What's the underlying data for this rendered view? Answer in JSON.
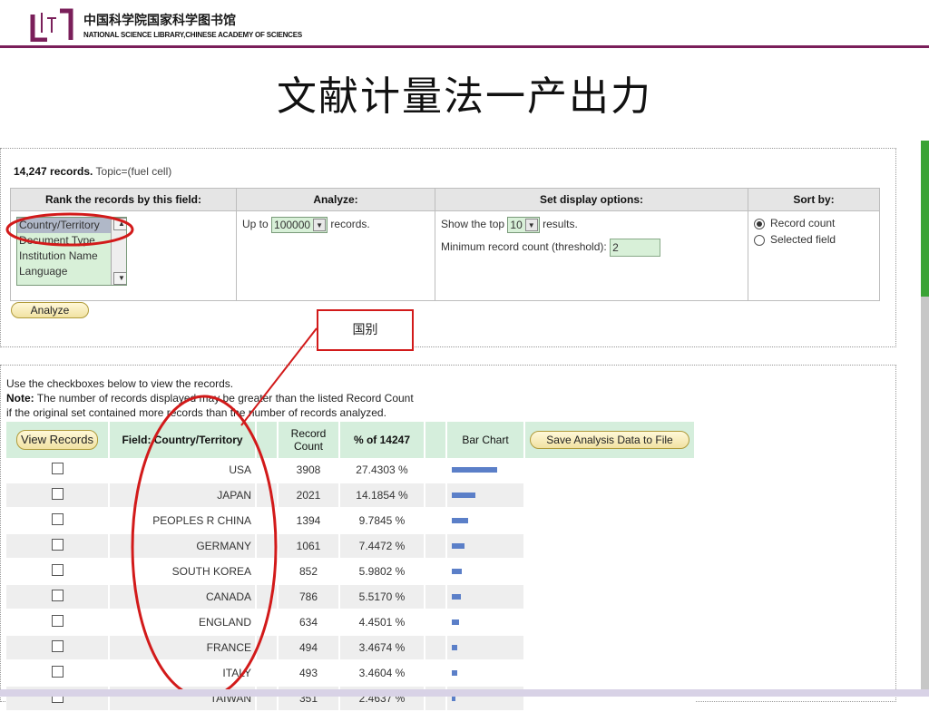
{
  "header": {
    "library_cn": "中国科学院国家科学图书馆",
    "library_en": "NATIONAL SCIENCE LIBRARY,CHINESE ACADEMY OF SCIENCES",
    "slide_title": "文献计量法一产出力"
  },
  "analysis": {
    "record_count": "14,247 records.",
    "topic": "Topic=(fuel cell)",
    "headers": {
      "rank": "Rank the records by this field:",
      "analyze": "Analyze:",
      "display": "Set display options:",
      "sort": "Sort by:"
    },
    "fields": [
      "Country/Territory",
      "Document Type",
      "Institution Name",
      "Language"
    ],
    "up_to_label": "Up to",
    "up_to_value": "100000",
    "records_suffix": "records.",
    "show_top_label": "Show the top",
    "show_top_value": "10",
    "results_suffix": "results.",
    "min_count_label": "Minimum record count (threshold):",
    "min_count_value": "2",
    "sort_options": [
      "Record count",
      "Selected field"
    ],
    "analyze_button": "Analyze"
  },
  "callout": {
    "label": "国别"
  },
  "results": {
    "note_line1": "Use the checkboxes below to view the records.",
    "note_bold": "Note:",
    "note_line2": " The number of records displayed may be greater than the listed Record Count",
    "note_line3": "if the original set contained more records than the number of records analyzed.",
    "view_button": "View Records",
    "field_header": "Field: Country/Territory",
    "count_header": "Record Count",
    "pct_header": "% of 14247",
    "bar_header": "Bar Chart",
    "save_button": "Save Analysis Data to File",
    "rows": [
      {
        "country": "USA",
        "count": "3908",
        "pct": "27.4303 %",
        "share": 27.4303
      },
      {
        "country": "JAPAN",
        "count": "2021",
        "pct": "14.1854 %",
        "share": 14.1854
      },
      {
        "country": "PEOPLES R CHINA",
        "count": "1394",
        "pct": "9.7845 %",
        "share": 9.7845
      },
      {
        "country": "GERMANY",
        "count": "1061",
        "pct": "7.4472 %",
        "share": 7.4472
      },
      {
        "country": "SOUTH KOREA",
        "count": "852",
        "pct": "5.9802 %",
        "share": 5.9802
      },
      {
        "country": "CANADA",
        "count": "786",
        "pct": "5.5170 %",
        "share": 5.517
      },
      {
        "country": "ENGLAND",
        "count": "634",
        "pct": "4.4501 %",
        "share": 4.4501
      },
      {
        "country": "FRANCE",
        "count": "494",
        "pct": "3.4674 %",
        "share": 3.4674
      },
      {
        "country": "ITALY",
        "count": "493",
        "pct": "3.4604 %",
        "share": 3.4604
      },
      {
        "country": "TAIWAN",
        "count": "351",
        "pct": "2.4637 %",
        "share": 2.4637
      }
    ]
  },
  "colors": {
    "accent_rule": "#7a1f5a",
    "bar": "#5b7fc8",
    "annotation": "#d21a1a",
    "green": "#3aa335"
  }
}
